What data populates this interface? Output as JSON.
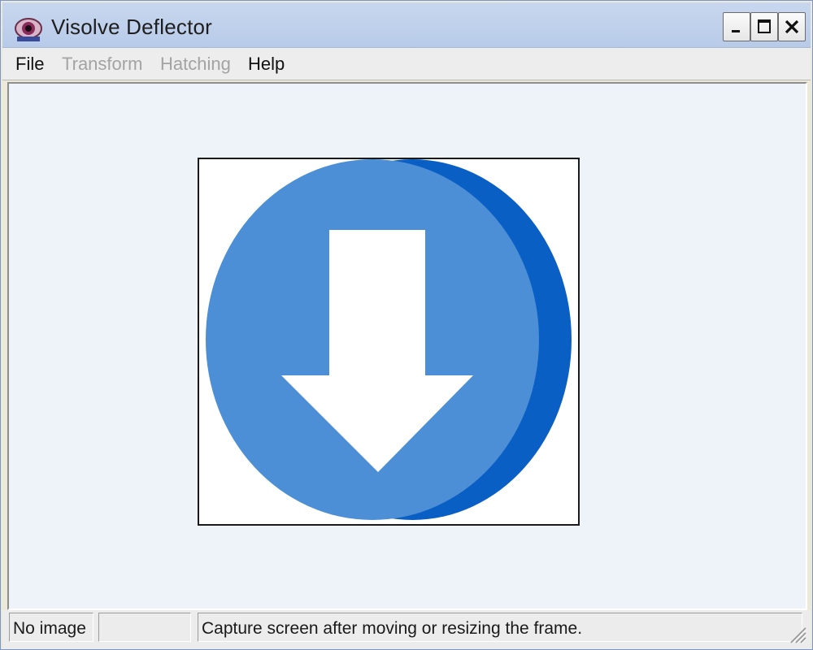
{
  "window": {
    "title": "Visolve Deflector",
    "icon": "eye-app-icon"
  },
  "titlebar_buttons": {
    "minimize": "minimize-icon",
    "maximize": "maximize-icon",
    "close": "close-icon"
  },
  "menu": {
    "items": [
      {
        "label": "File",
        "enabled": true
      },
      {
        "label": "Transform",
        "enabled": false
      },
      {
        "label": "Hatching",
        "enabled": false
      },
      {
        "label": "Help",
        "enabled": true
      }
    ]
  },
  "content": {
    "image_icon": "download-arrow-icon",
    "colors": {
      "circle_front": "#4c8fd6",
      "circle_back": "#0a5fc4",
      "arrow": "#ffffff",
      "client_bg": "#eef3f9"
    }
  },
  "status": {
    "pane1": "No image",
    "pane2": "",
    "pane3": "Capture screen after moving or resizing the frame."
  }
}
